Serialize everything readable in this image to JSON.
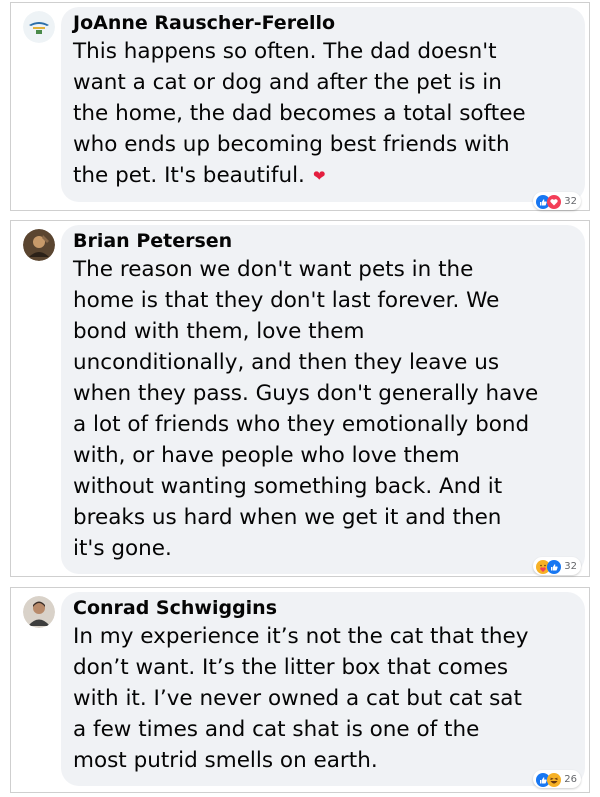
{
  "comments": [
    {
      "author": "JoAnne Rauscher-Ferello",
      "text": "This happens so often. The dad doesn't\nwant a cat or dog and after the pet is in\nthe home, the dad becomes a total softee\nwho ends up becoming best friends with\nthe pet. It's beautiful.",
      "inline_emoji": "heart-emoji",
      "reactions": {
        "icons": [
          "like-icon",
          "love-icon"
        ],
        "count": "32"
      }
    },
    {
      "author": "Brian Petersen",
      "text": "The reason we don't want pets in the\nhome is that they don't last forever. We\nbond with them, love them\nunconditionally, and then they leave us\nwhen they pass. Guys don't generally have\na lot of friends who they emotionally bond\nwith, or have people who love them\nwithout wanting something back. And it\nbreaks us hard when we get it and then\nit's gone.",
      "reactions": {
        "icons": [
          "care-icon",
          "like-icon"
        ],
        "count": "32"
      }
    },
    {
      "author": "Conrad Schwiggins",
      "text": "In my experience it’s not the cat that they\ndon’t want. It’s the litter box that comes\nwith it. I’ve never owned a cat but cat sat\na few times and cat shat is one of the\nmost putrid smells on earth.",
      "reactions": {
        "icons": [
          "like-icon",
          "haha-icon"
        ],
        "count": "26"
      }
    }
  ],
  "colors": {
    "like": "#1877f2",
    "love": "#f33e58",
    "haha": "#f7b125",
    "bubble": "#f0f2f5"
  }
}
